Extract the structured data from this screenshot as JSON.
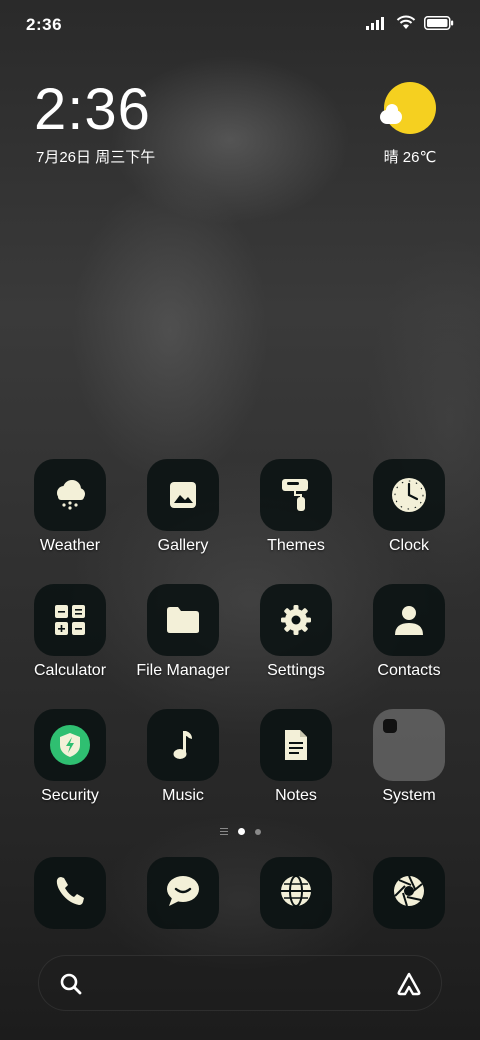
{
  "status_bar": {
    "time": "2:36",
    "icons": [
      "signal-icon",
      "wifi-icon",
      "battery-icon"
    ]
  },
  "clock_widget": {
    "time": "2:36",
    "date": "7月26日 周三下午"
  },
  "weather_widget": {
    "text": "晴 26℃",
    "icon": "sunny-cloud-icon",
    "sun_color": "#f5d020"
  },
  "apps": [
    {
      "label": "Weather",
      "icon": "weather-icon"
    },
    {
      "label": "Gallery",
      "icon": "gallery-icon"
    },
    {
      "label": "Themes",
      "icon": "themes-icon"
    },
    {
      "label": "Clock",
      "icon": "clock-icon"
    },
    {
      "label": "Calculator",
      "icon": "calculator-icon"
    },
    {
      "label": "File Manager",
      "icon": "folder-icon"
    },
    {
      "label": "Settings",
      "icon": "gear-icon"
    },
    {
      "label": "Contacts",
      "icon": "person-icon"
    },
    {
      "label": "Security",
      "icon": "shield-icon"
    },
    {
      "label": "Music",
      "icon": "music-note-icon"
    },
    {
      "label": "Notes",
      "icon": "notes-icon"
    },
    {
      "label": "System",
      "icon": "folder-icon"
    }
  ],
  "page_indicator": {
    "pages": 2,
    "current": 1
  },
  "dock": [
    {
      "icon": "phone-icon"
    },
    {
      "icon": "message-icon"
    },
    {
      "icon": "browser-icon"
    },
    {
      "icon": "camera-icon"
    }
  ],
  "colors": {
    "icon_fg": "#f3f0d8",
    "tile_bg": "#0a1212",
    "security_green": "#2fbf71"
  }
}
